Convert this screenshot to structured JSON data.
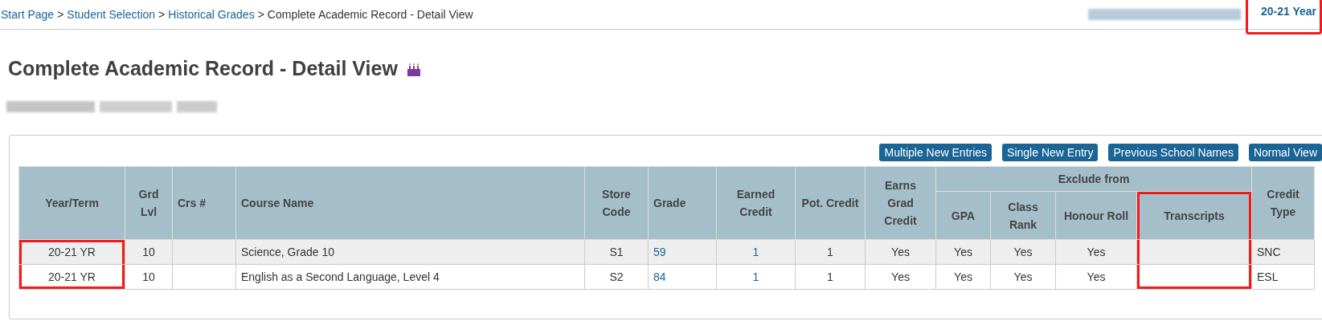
{
  "breadcrumb": [
    {
      "label": "Start Page",
      "link": true
    },
    {
      "label": "Student Selection",
      "link": true
    },
    {
      "label": "Historical Grades",
      "link": true
    },
    {
      "label": "Complete Academic Record - Detail View",
      "link": false
    }
  ],
  "breadcrumb_separator": ">",
  "term_link": {
    "label": "20-21 Year",
    "highlighted": true
  },
  "title": "Complete Academic Record - Detail View",
  "buttons": [
    "Multiple New Entries",
    "Single New Entry",
    "Previous School Names",
    "Normal View"
  ],
  "table": {
    "group_header": "Exclude from",
    "columns": [
      {
        "label": "Year/Term",
        "highlighted": true
      },
      {
        "label": "Grd Lvl",
        "highlighted": false
      },
      {
        "label": "Crs #",
        "highlighted": false
      },
      {
        "label": "Course Name",
        "highlighted": false
      },
      {
        "label": "Store Code",
        "highlighted": false
      },
      {
        "label": "Grade",
        "highlighted": false
      },
      {
        "label": "Earned Credit",
        "highlighted": false
      },
      {
        "label": "Pot. Credit",
        "highlighted": false
      },
      {
        "label": "Earns Grad Credit",
        "highlighted": false
      },
      {
        "label": "GPA",
        "highlighted": false
      },
      {
        "label": "Class Rank",
        "highlighted": false
      },
      {
        "label": "Honour Roll",
        "highlighted": false
      },
      {
        "label": "Transcripts",
        "highlighted": true
      },
      {
        "label": "Credit Type",
        "highlighted": false
      }
    ],
    "rows": [
      [
        "20-21 YR",
        "10",
        "",
        "Science, Grade 10",
        "S1",
        "59",
        "1",
        "1",
        "Yes",
        "Yes",
        "Yes",
        "Yes",
        "",
        "SNC"
      ],
      [
        "20-21 YR",
        "10",
        "",
        "English as a Second Language, Level 4",
        "S2",
        "84",
        "1",
        "1",
        "Yes",
        "Yes",
        "Yes",
        "Yes",
        "",
        "ESL"
      ]
    ]
  }
}
